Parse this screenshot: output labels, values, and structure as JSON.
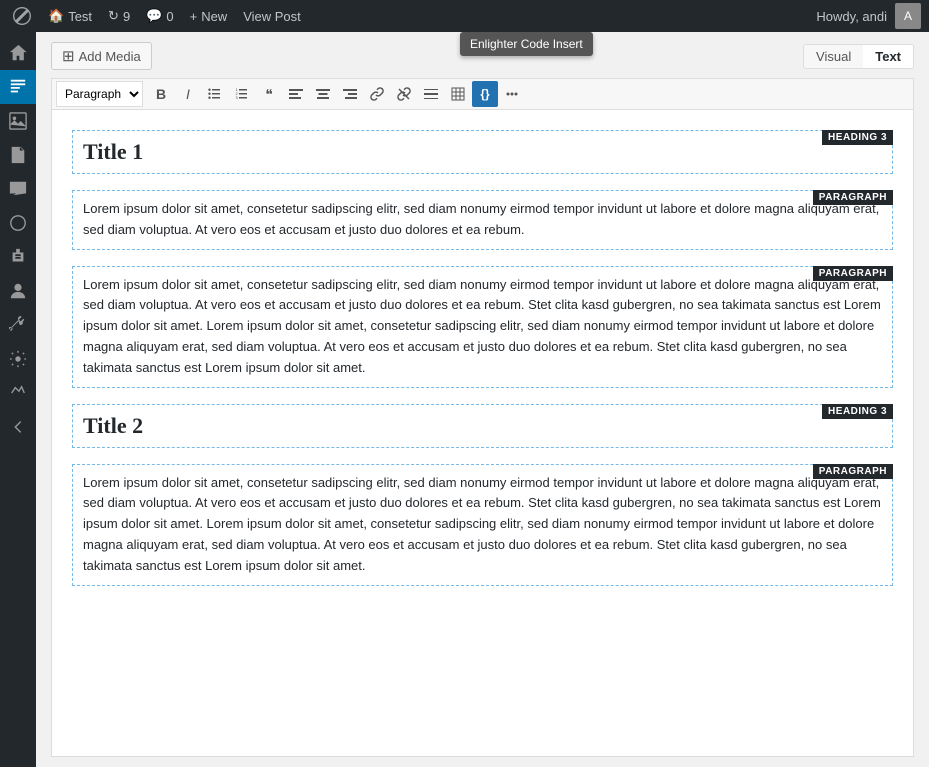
{
  "adminbar": {
    "logo": "W",
    "items": [
      {
        "id": "site-name",
        "label": "Test",
        "icon": "🏠"
      },
      {
        "id": "updates",
        "label": "9",
        "icon": "🔄"
      },
      {
        "id": "comments",
        "label": "0",
        "icon": "💬"
      },
      {
        "id": "new",
        "label": "New"
      },
      {
        "id": "view-post",
        "label": "View Post"
      }
    ],
    "howdy": "Howdy, andi"
  },
  "sidebar": {
    "items": [
      {
        "id": "dashboard",
        "icon": "⊞"
      },
      {
        "id": "posts",
        "icon": "📄"
      },
      {
        "id": "media",
        "icon": "🖼"
      },
      {
        "id": "pages",
        "icon": "📋"
      },
      {
        "id": "comments",
        "icon": "💬"
      },
      {
        "id": "appearance",
        "icon": "🎨"
      },
      {
        "id": "plugins",
        "icon": "🔌"
      },
      {
        "id": "users",
        "icon": "👤"
      },
      {
        "id": "tools",
        "icon": "🔧"
      },
      {
        "id": "settings",
        "icon": "⚙"
      },
      {
        "id": "collapse",
        "icon": "◀"
      }
    ]
  },
  "toolbar": {
    "add_media_label": "Add Media",
    "tabs": {
      "visual": "Visual",
      "text": "Text",
      "active": "text"
    },
    "format_select": "Paragraph",
    "buttons": [
      {
        "id": "bold",
        "symbol": "B",
        "title": "Bold"
      },
      {
        "id": "italic",
        "symbol": "I",
        "title": "Italic"
      },
      {
        "id": "unordered-list",
        "symbol": "≡",
        "title": "Unordered List"
      },
      {
        "id": "ordered-list",
        "symbol": "≣",
        "title": "Ordered List"
      },
      {
        "id": "blockquote",
        "symbol": "❝",
        "title": "Blockquote"
      },
      {
        "id": "align-left",
        "symbol": "⫿",
        "title": "Align Left"
      },
      {
        "id": "align-center",
        "symbol": "☰",
        "title": "Align Center"
      },
      {
        "id": "align-right",
        "symbol": "☷",
        "title": "Align Right"
      },
      {
        "id": "link",
        "symbol": "🔗",
        "title": "Link"
      },
      {
        "id": "unlink",
        "symbol": "⛓",
        "title": "Unlink"
      },
      {
        "id": "hr",
        "symbol": "—",
        "title": "Horizontal Rule"
      },
      {
        "id": "table",
        "symbol": "⊞",
        "title": "Table"
      },
      {
        "id": "code",
        "symbol": "{}",
        "title": "Code"
      },
      {
        "id": "more",
        "symbol": "✎",
        "title": "More"
      }
    ],
    "tooltip": "Enlighter Code Insert",
    "expand": "⤢"
  },
  "content": {
    "blocks": [
      {
        "id": "block-1",
        "type": "heading",
        "label": "HEADING 3",
        "text": "Title 1"
      },
      {
        "id": "block-2",
        "type": "paragraph",
        "label": "PARAGRAPH",
        "text": "Lorem ipsum dolor sit amet, consetetur sadipscing elitr, sed diam nonumy eirmod tempor invidunt ut labore et dolore magna aliquyam erat, sed diam voluptua. At vero eos et accusam et justo duo dolores et ea rebum."
      },
      {
        "id": "block-3",
        "type": "paragraph",
        "label": "PARAGRAPH",
        "text": "Lorem ipsum dolor sit amet, consetetur sadipscing elitr, sed diam nonumy eirmod tempor invidunt ut labore et dolore magna aliquyam erat, sed diam voluptua. At vero eos et accusam et justo duo dolores et ea rebum. Stet clita kasd gubergren, no sea takimata sanctus est Lorem ipsum dolor sit amet. Lorem ipsum dolor sit amet, consetetur sadipscing elitr, sed diam nonumy eirmod tempor invidunt ut labore et dolore magna aliquyam erat, sed diam voluptua. At vero eos et accusam et justo duo dolores et ea rebum. Stet clita kasd gubergren, no sea takimata sanctus est Lorem ipsum dolor sit amet."
      },
      {
        "id": "block-4",
        "type": "heading",
        "label": "HEADING 3",
        "text": "Title 2"
      },
      {
        "id": "block-5",
        "type": "paragraph",
        "label": "PARAGRAPH",
        "text": "Lorem ipsum dolor sit amet, consetetur sadipscing elitr, sed diam nonumy eirmod tempor invidunt ut labore et dolore magna aliquyam erat, sed diam voluptua. At vero eos et accusam et justo duo dolores et ea rebum. Stet clita kasd gubergren, no sea takimata sanctus est Lorem ipsum dolor sit amet. Lorem ipsum dolor sit amet, consetetur sadipscing elitr, sed diam nonumy eirmod tempor invidunt ut labore et dolore magna aliquyam erat, sed diam voluptua. At vero eos et accusam et justo duo dolores et ea rebum. Stet clita kasd gubergren, no sea takimata sanctus est Lorem ipsum dolor sit amet."
      }
    ]
  }
}
